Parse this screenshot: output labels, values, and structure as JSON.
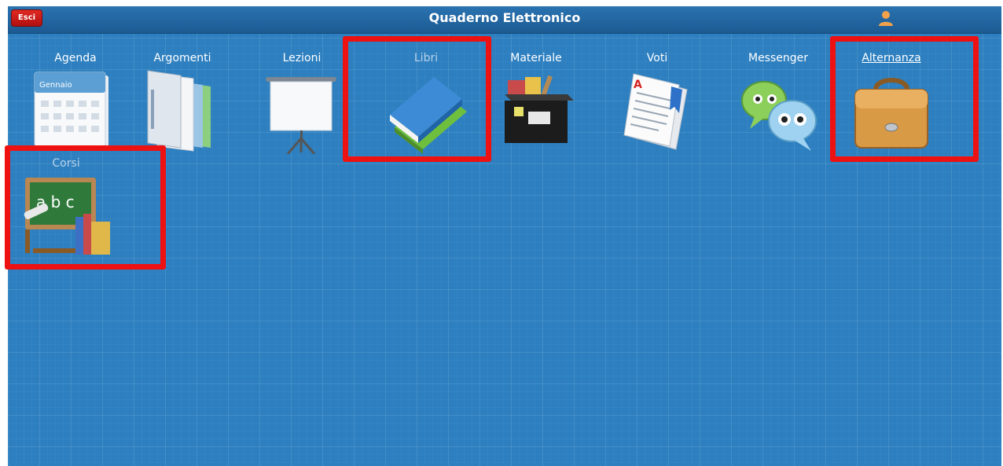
{
  "header": {
    "title": "Quaderno Elettronico",
    "exit_label": "Esci",
    "user_icon": "user-icon"
  },
  "tiles": [
    {
      "label": "Agenda",
      "icon": "calendar-icon",
      "caption": "Gennaio",
      "highlighted": false
    },
    {
      "label": "Argomenti",
      "icon": "folders-icon",
      "highlighted": false
    },
    {
      "label": "Lezioni",
      "icon": "projector-screen-icon",
      "highlighted": false
    },
    {
      "label": "Libri",
      "icon": "books-icon",
      "highlighted": true
    },
    {
      "label": "Materiale",
      "icon": "storage-box-icon",
      "highlighted": false
    },
    {
      "label": "Voti",
      "icon": "graded-paper-icon",
      "highlighted": false
    },
    {
      "label": "Messenger",
      "icon": "chat-bubbles-icon",
      "highlighted": false
    },
    {
      "label": "Alternanza",
      "icon": "briefcase-icon",
      "highlighted": true
    },
    {
      "label": "Corsi",
      "icon": "chalkboard-icon",
      "board_text": "a b c",
      "highlighted": true
    }
  ],
  "colors": {
    "background": "#2d7fc0",
    "topbar": "#1c5a92",
    "highlight": "#ee1111",
    "exit_button": "#c8161a"
  }
}
